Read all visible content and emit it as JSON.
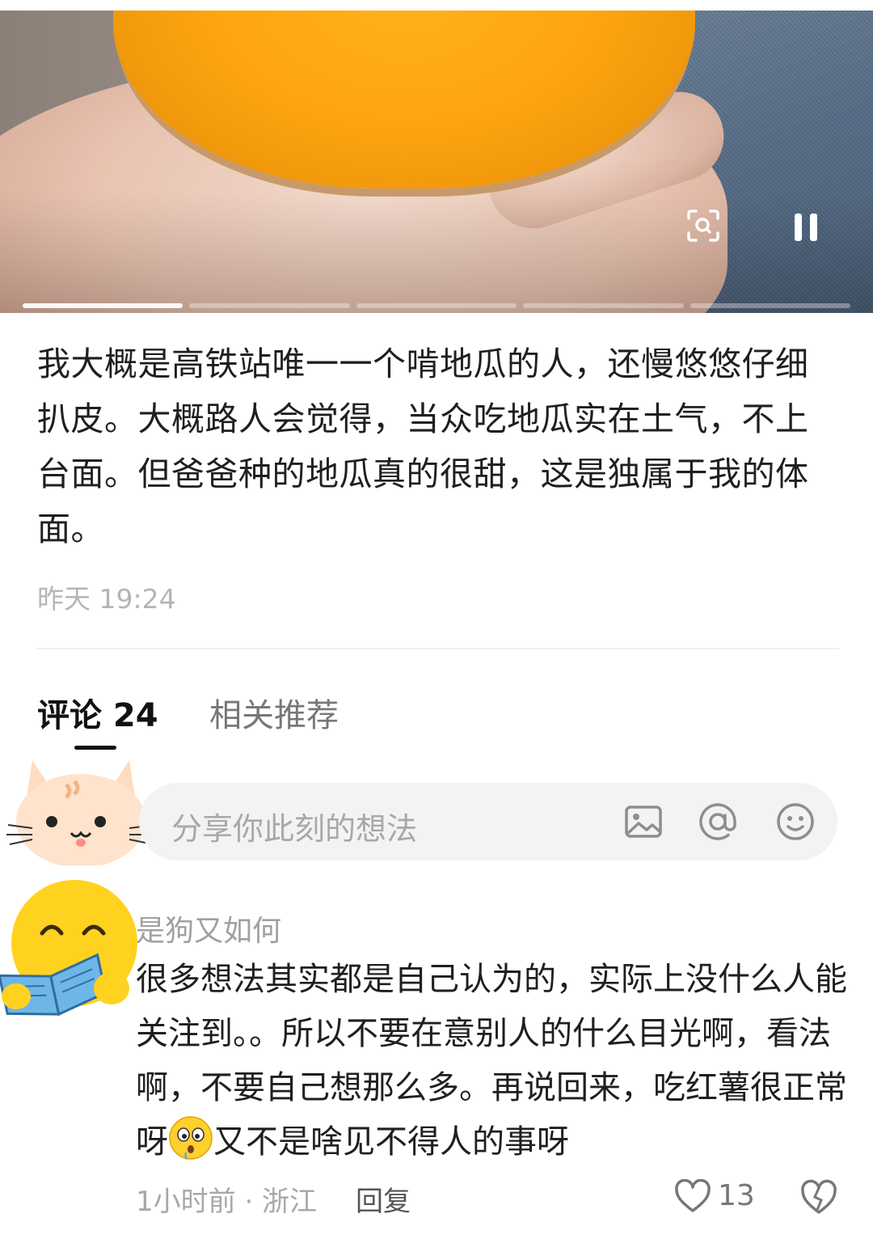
{
  "post": {
    "text": "我大概是高铁站唯一一个啃地瓜的人，还慢悠悠仔细扒皮。大概路人会觉得，当众吃地瓜实在土气，不上台面。但爸爸种的地瓜真的很甜，这是独属于我的体面。",
    "time": "昨天 19:24"
  },
  "video": {
    "progress_segments": 5,
    "active_segment": 1,
    "scan_icon": "scan-search-icon",
    "pause_icon": "pause-icon"
  },
  "tabs": {
    "comments_label": "评论 24",
    "related_label": "相关推荐"
  },
  "comment_input": {
    "placeholder": "分享你此刻的想法",
    "icons": [
      "image-icon",
      "at-icon",
      "emoji-icon"
    ]
  },
  "comment": {
    "author": "是狗又如何",
    "text_part1": "很多想法其实都是自己认为的，实际上没什么人能关注到。。所以不要在意别人的什么目光啊，看法啊，不要自己想那么多。再说回来，吃红薯很正常呀",
    "text_part2": "又不是啥见不得人的事呀",
    "meta": "1小时前 · 浙江",
    "reply_label": "回复",
    "like_count": "13"
  },
  "colors": {
    "potato": "#ffa510",
    "input_bg": "#f3f3f3",
    "muted_text": "#a8a8a8"
  }
}
